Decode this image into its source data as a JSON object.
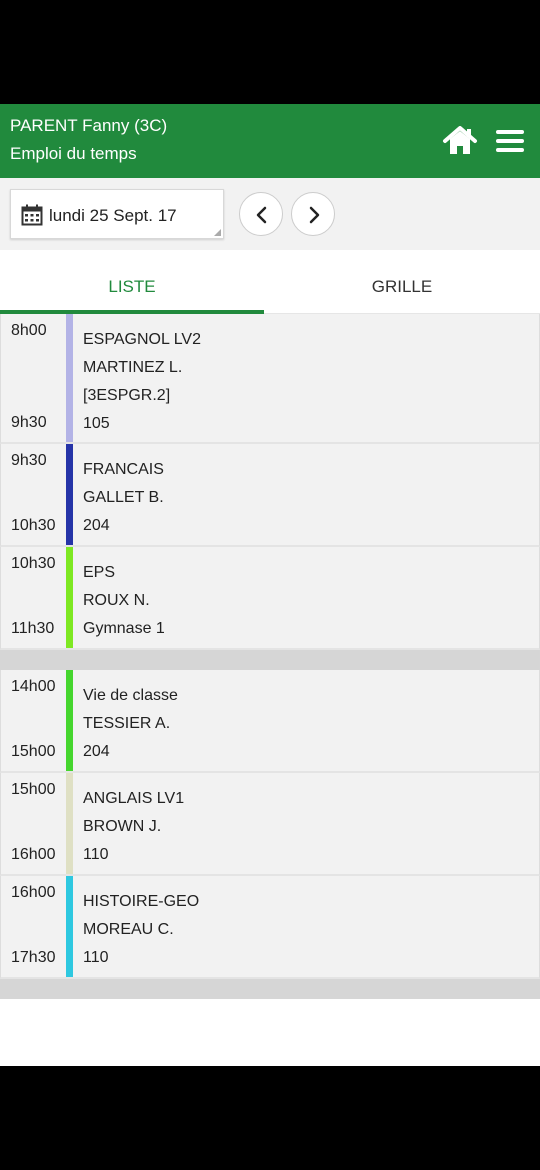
{
  "header": {
    "name": "PARENT Fanny (3C)",
    "subtitle": "Emploi du temps",
    "icons": {
      "home": "home-icon",
      "menu": "hamburger-menu-icon"
    }
  },
  "datebar": {
    "date": "lundi 25 Sept. 17",
    "icons": {
      "calendar": "calendar-icon",
      "prev": "chevron-left-icon",
      "next": "chevron-right-icon"
    }
  },
  "tabs": [
    {
      "label": "LISTE",
      "active": true
    },
    {
      "label": "GRILLE",
      "active": false
    }
  ],
  "colors": {
    "brand": "#218a3d",
    "espagnol": "#b3b3e6",
    "francais": "#2634a8",
    "eps": "#7ee822",
    "vie_de_classe": "#45d62e",
    "anglais": "#dfe0c4",
    "histoire_geo": "#2ec8e0"
  },
  "lessons": [
    {
      "start": "8h00",
      "end": "9h30",
      "subject": "ESPAGNOL LV2",
      "teacher": "MARTINEZ L.",
      "group": "[3ESPGR.2]",
      "room": "105"
    },
    {
      "start": "9h30",
      "end": "10h30",
      "subject": "FRANCAIS",
      "teacher": "GALLET B.",
      "room": "204"
    },
    {
      "start": "10h30",
      "end": "11h30",
      "subject": "EPS",
      "teacher": "ROUX N.",
      "room": "Gymnase 1"
    },
    {
      "start": "14h00",
      "end": "15h00",
      "subject": "Vie de classe",
      "teacher": "TESSIER A.",
      "room": "204"
    },
    {
      "start": "15h00",
      "end": "16h00",
      "subject": "ANGLAIS LV1",
      "teacher": "BROWN J.",
      "room": "110"
    },
    {
      "start": "16h00",
      "end": "17h30",
      "subject": "HISTOIRE-GEO",
      "teacher": "MOREAU C.",
      "room": "110"
    }
  ]
}
